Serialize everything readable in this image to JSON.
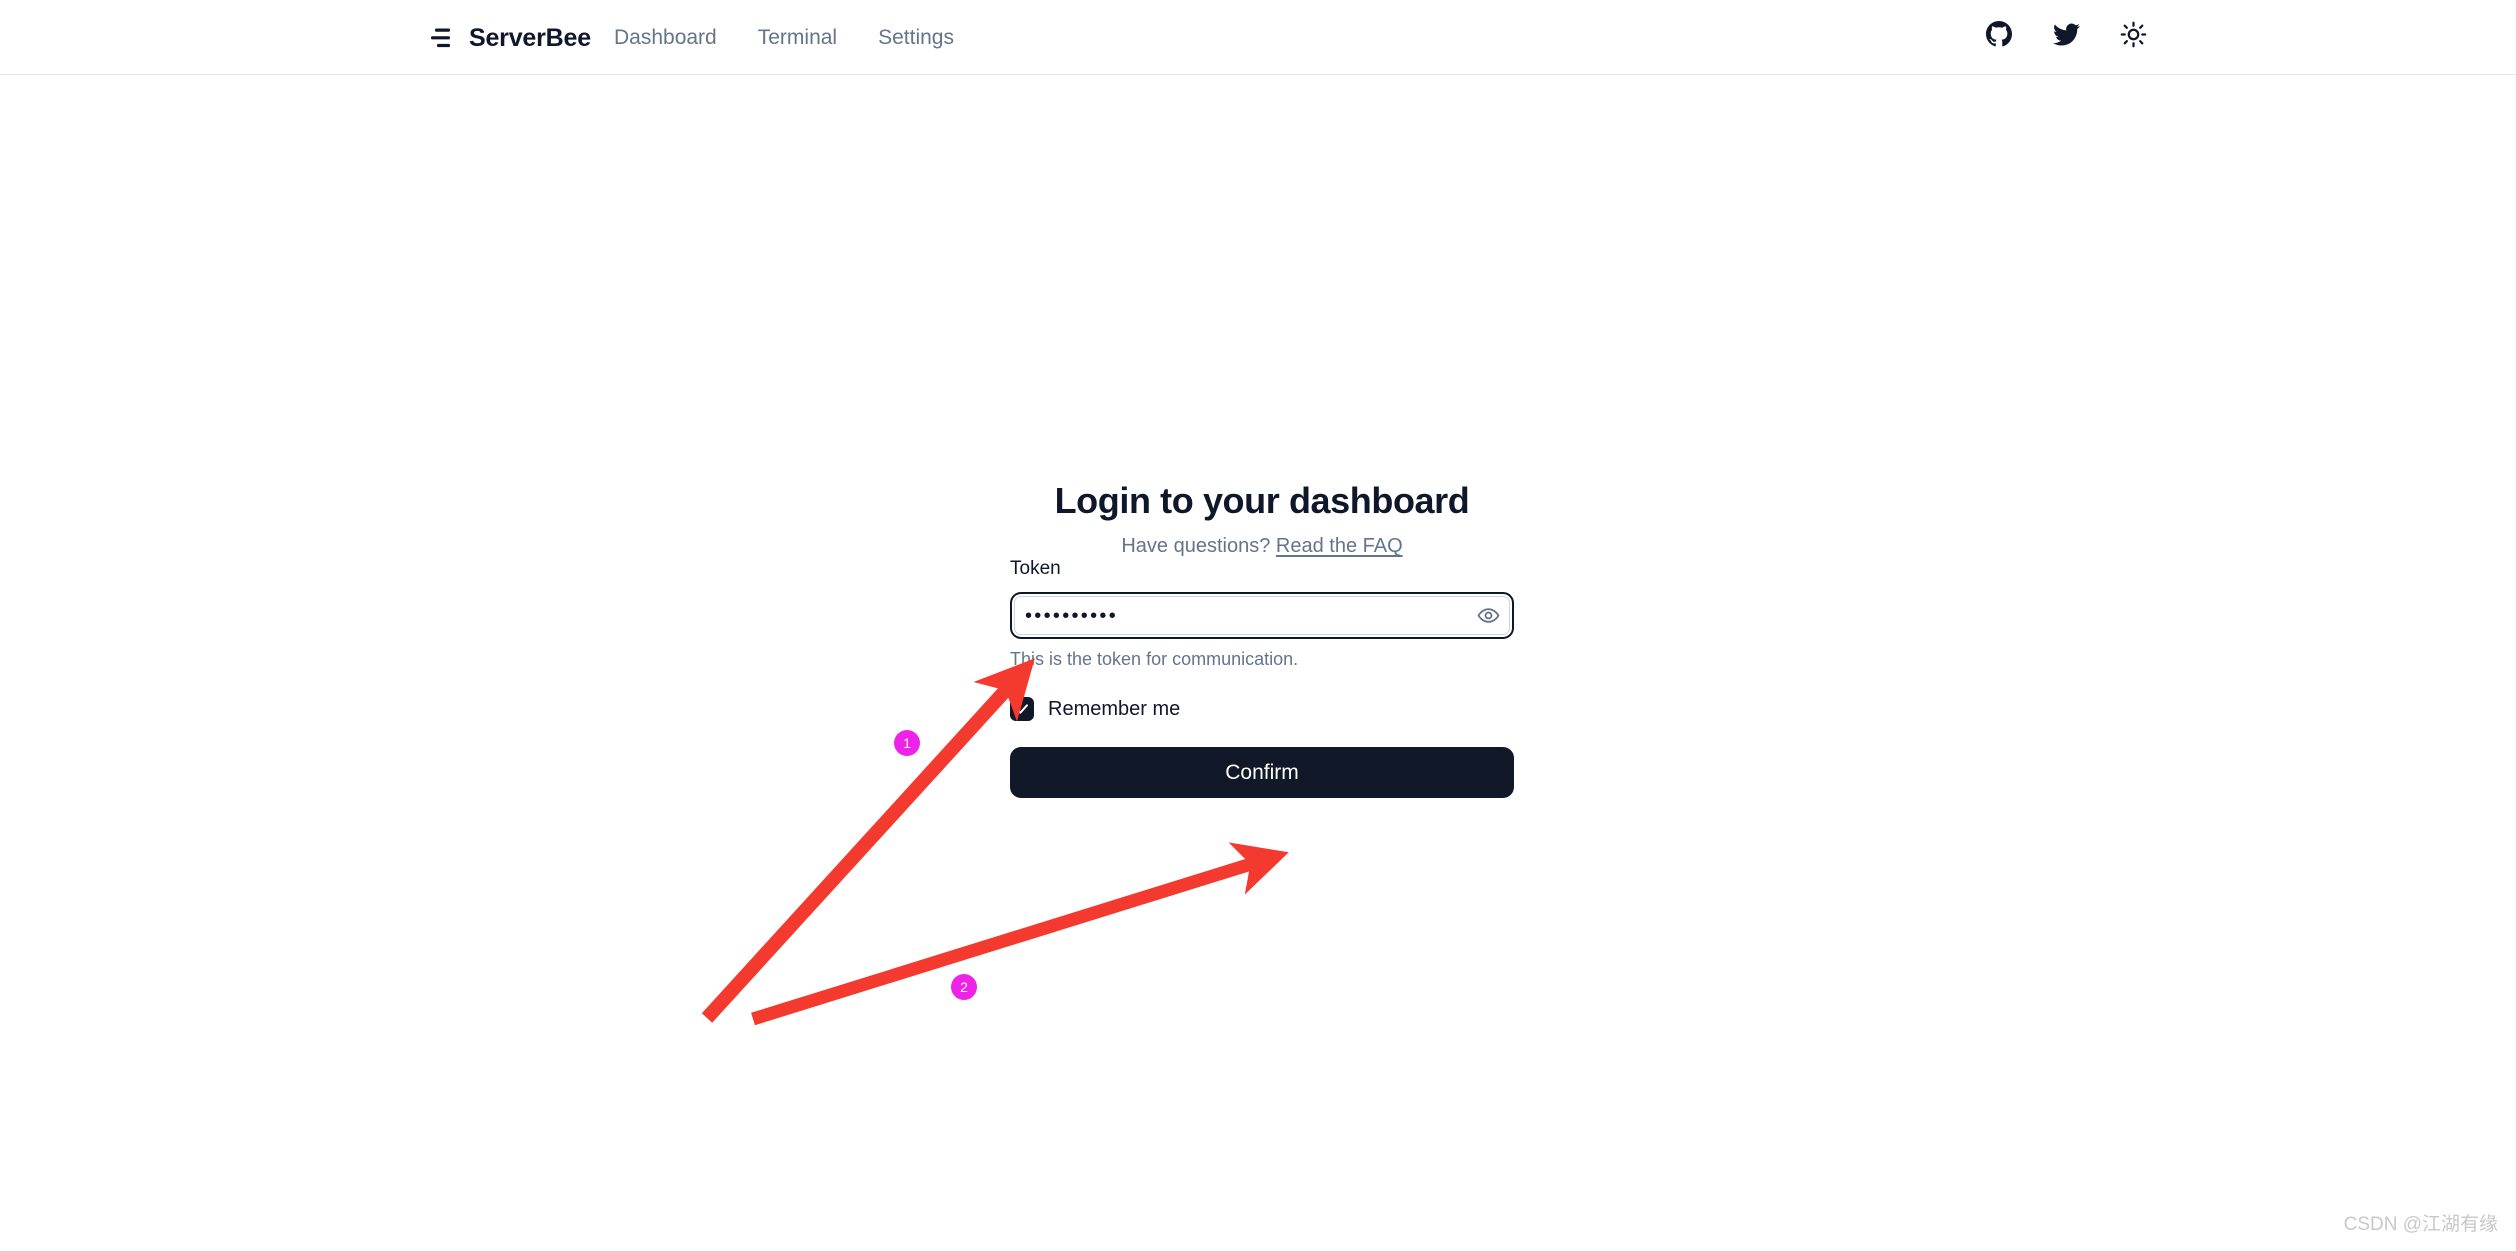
{
  "header": {
    "logo_icon": "stacked-lines-logo-icon",
    "brand": "ServerBee",
    "nav": [
      {
        "label": "Dashboard"
      },
      {
        "label": "Terminal"
      },
      {
        "label": "Settings"
      }
    ],
    "actions": [
      {
        "icon": "github-icon",
        "label": "GitHub"
      },
      {
        "icon": "twitter-icon",
        "label": "Twitter"
      },
      {
        "icon": "sun-icon",
        "label": "Toggle theme"
      }
    ]
  },
  "login": {
    "title": "Login to your dashboard",
    "subtitle_prefix": "Have questions? ",
    "faq_link": "Read the FAQ",
    "token_label": "Token",
    "token_value": "••••••••••",
    "token_placeholder": "",
    "token_help": "This is the token for communication.",
    "eye_icon": "eye-icon",
    "remember_label": "Remember me",
    "remember_checked": true,
    "confirm_label": "Confirm"
  },
  "annotations": {
    "badges": [
      {
        "number": "1"
      },
      {
        "number": "2"
      }
    ],
    "arrow_color": "#f4392f",
    "badge_color": "#ef23e8"
  },
  "watermark": "CSDN @江湖有缘"
}
